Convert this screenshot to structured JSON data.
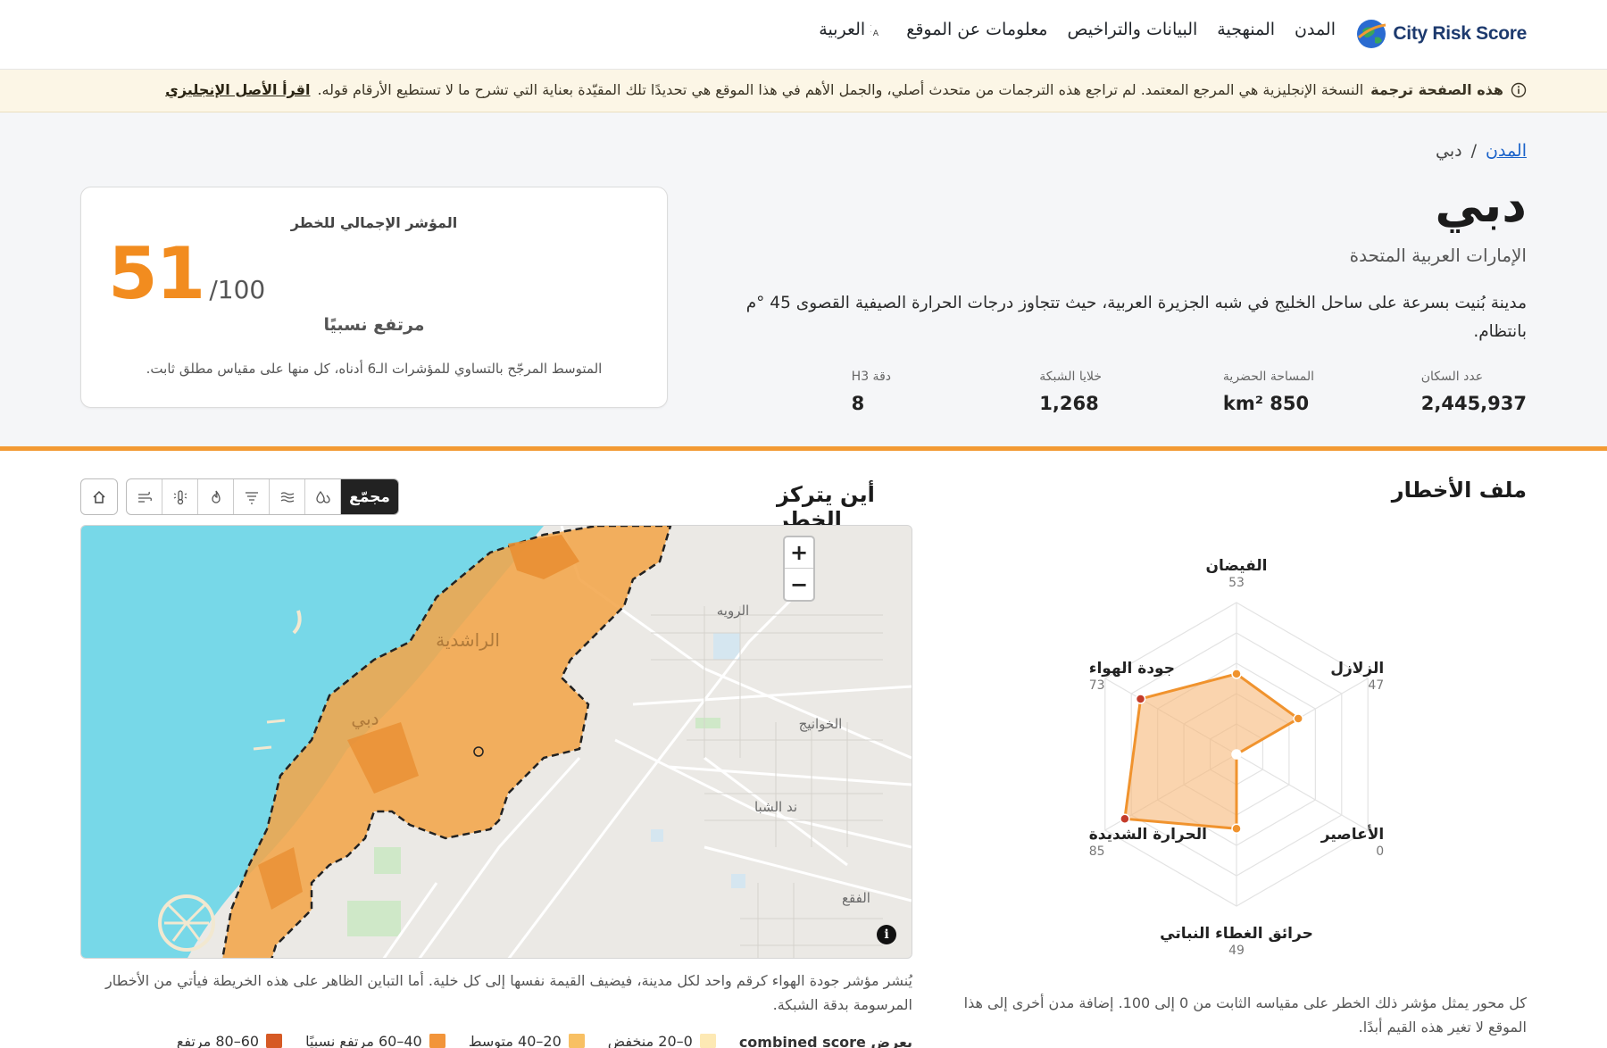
{
  "header": {
    "logo_text": "City Risk Score",
    "nav": [
      "المدن",
      "المنهجية",
      "البيانات والتراخيص",
      "معلومات عن الموقع"
    ],
    "language": "العربية"
  },
  "banner": {
    "bold": "هذه الصفحة ترجمة",
    "text": "النسخة الإنجليزية هي المرجع المعتمد. لم تراجع هذه الترجمات من متحدث أصلي، والجمل الأهم في هذا الموقع هي تحديدًا تلك المقيّدة بعناية التي تشرح ما لا تستطيع الأرقام قوله.",
    "link": "اقرأ الأصل الإنجليزي"
  },
  "breadcrumb": {
    "cities": "المدن",
    "separator": "/",
    "current": "دبي"
  },
  "city": {
    "name": "دبي",
    "country": "الإمارات العربية المتحدة",
    "description": "مدينة بُنيت بسرعة على ساحل الخليج في شبه الجزيرة العربية، حيث تتجاوز درجات الحرارة الصيفية القصوى 45 °م بانتظام."
  },
  "stats": [
    {
      "label": "عدد السكان",
      "value": "2,445,937"
    },
    {
      "label": "المساحة الحضرية",
      "value": "km² 850"
    },
    {
      "label": "خلايا الشبكة",
      "value": "1,268"
    },
    {
      "label": "دقة H3",
      "value": "8"
    }
  ],
  "score": {
    "label": "المؤشر الإجمالي للخطر",
    "value": "51",
    "denominator": "/100",
    "category": "مرتفع نسبيًا",
    "note": "المتوسط المرجّح بالتساوي للمؤشرات الـ6 أدناه، كل منها على مقياس مطلق ثابت."
  },
  "radar": {
    "title": "ملف الأخطار",
    "axes": [
      {
        "name": "الفيضان",
        "value": 53
      },
      {
        "name": "الزلازل",
        "value": 47
      },
      {
        "name": "الأعاصير",
        "value": 0
      },
      {
        "name": "حرائق الغطاء النباتي",
        "value": 49
      },
      {
        "name": "الحرارة الشديدة",
        "value": 85
      },
      {
        "name": "جودة الهواء",
        "value": 73
      }
    ],
    "max": 100,
    "note": "كل محور يمثل مؤشر ذلك الخطر على مقياسه الثابت من 0 إلى 100. إضافة مدن أخرى إلى هذا الموقع لا تغير هذه القيم أبدًا."
  },
  "map": {
    "title": "أين يتركز الخطر",
    "active_layer": "مجمّع",
    "zoom_in": "+",
    "zoom_out": "−",
    "info": "i",
    "place_labels": [
      "الراشدية",
      "دبي",
      "الرويه",
      "الخوانيج",
      "ند الشبا",
      "الفقع"
    ],
    "caption": "يُنشر مؤشر جودة الهواء كرقم واحد لكل مدينة، فيضيف القيمة نفسها إلى كل خلية. أما التباين الظاهر على هذه الخريطة فيأتي من الأخطار المرسومة بدقة الشبكة.",
    "legend_title": "يعرض combined score",
    "legend": [
      {
        "label": "0–20 منخفض",
        "color": "#fde9b4"
      },
      {
        "label": "20–40 متوسط",
        "color": "#f8c063"
      },
      {
        "label": "40–60 مرتفع نسبيًا",
        "color": "#f2953a"
      },
      {
        "label": "60–80 مرتفع",
        "color": "#d65a25"
      }
    ]
  },
  "colors": {
    "accent": "#f28c1f",
    "radar_fill": "#f6b878",
    "radar_stroke": "#f0932e",
    "high_point": "#c43b2a"
  }
}
